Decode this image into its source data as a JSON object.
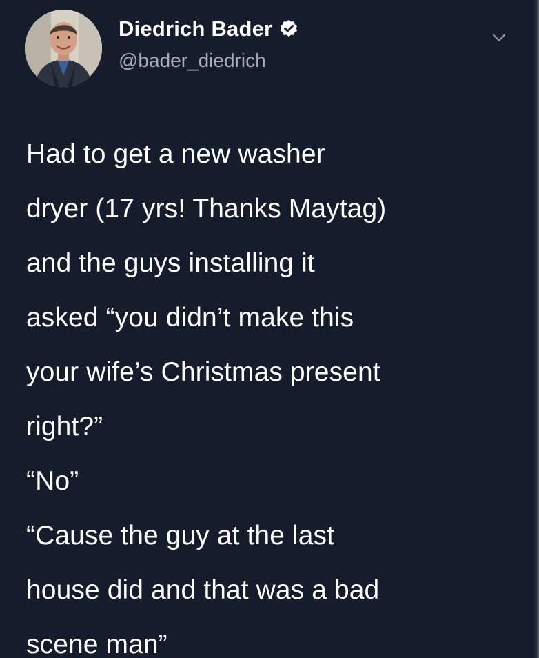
{
  "tweet": {
    "author": {
      "display_name": "Diedrich Bader",
      "handle": "@bader_diedrich",
      "verified": true
    },
    "text_lines": [
      "Had to get a new washer",
      "dryer (17 yrs! Thanks Maytag)",
      "and the guys installing it",
      "asked “you didn’t make this",
      "your wife’s Christmas present",
      "right?”",
      "“No”",
      "“Cause the guy at the last",
      "house did and that was a bad",
      "scene man”"
    ]
  },
  "icons": {
    "verified": "verified-badge-icon",
    "menu": "chevron-down-icon"
  },
  "colors": {
    "background": "#151c2b",
    "text": "#ffffff",
    "secondary_text": "#a7aeb8",
    "verified_badge": "#ffffff"
  }
}
